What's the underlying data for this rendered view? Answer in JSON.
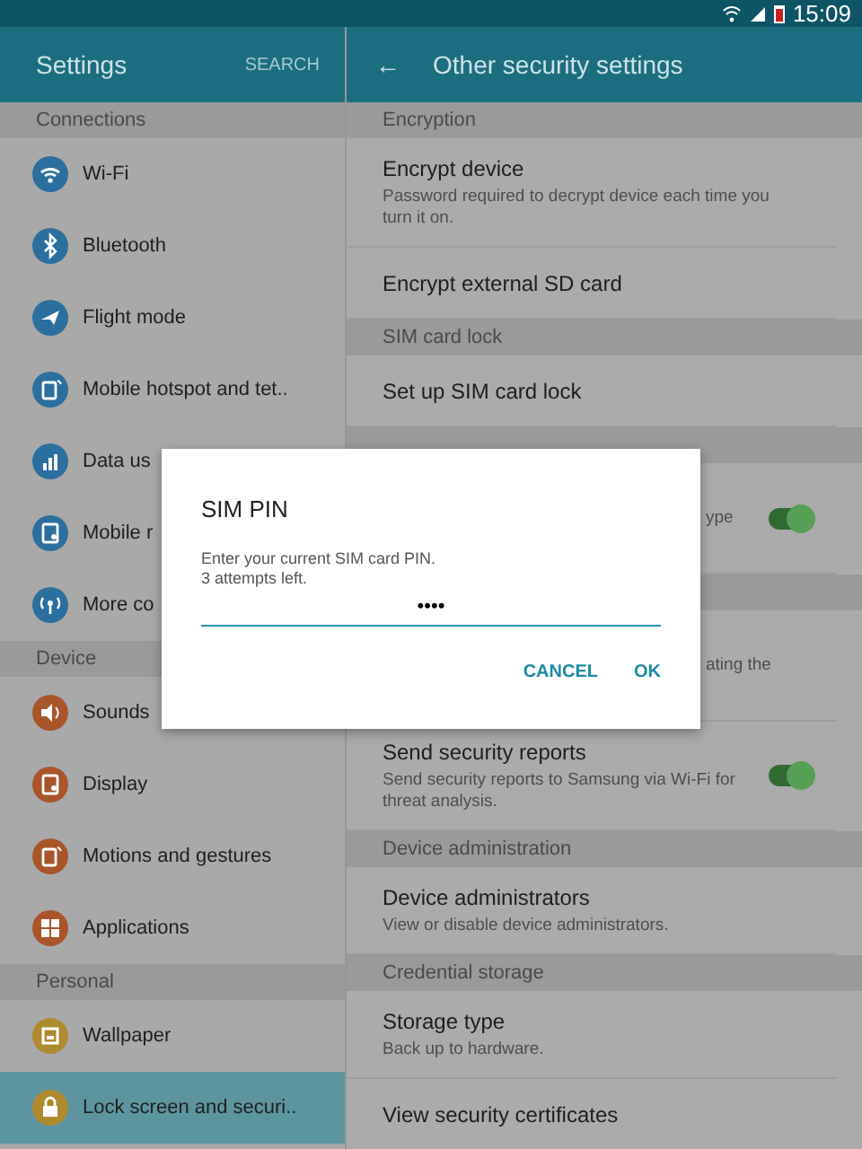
{
  "status_bar": {
    "time": "15:09"
  },
  "left": {
    "title": "Settings",
    "search": "SEARCH",
    "sections": [
      {
        "header": "Connections",
        "items": [
          {
            "label": "Wi-Fi",
            "kind": "wifi",
            "color": "#2a6f9e",
            "selected": false
          },
          {
            "label": "Bluetooth",
            "kind": "bluetooth",
            "color": "#2a6f9e",
            "selected": false
          },
          {
            "label": "Flight mode",
            "kind": "plane",
            "color": "#2a6f9e",
            "selected": false
          },
          {
            "label": "Mobile hotspot and tet..",
            "kind": "hotspot",
            "color": "#2a6f9e",
            "selected": false
          },
          {
            "label": "Data us",
            "kind": "bars",
            "color": "#2a6f9e",
            "selected": false
          },
          {
            "label": "Mobile r",
            "kind": "phone",
            "color": "#2a6f9e",
            "selected": false
          },
          {
            "label": "More co",
            "kind": "antenna",
            "color": "#2a6f9e",
            "selected": false
          }
        ]
      },
      {
        "header": "Device",
        "items": [
          {
            "label": "Sounds",
            "kind": "speaker",
            "color": "#a8552a",
            "selected": false
          },
          {
            "label": "Display",
            "kind": "phone",
            "color": "#a8552a",
            "selected": false
          },
          {
            "label": "Motions and gestures",
            "kind": "hotspot",
            "color": "#a8552a",
            "selected": false
          },
          {
            "label": "Applications",
            "kind": "grid",
            "color": "#a8552a",
            "selected": false
          }
        ]
      },
      {
        "header": "Personal",
        "items": [
          {
            "label": "Wallpaper",
            "kind": "frame",
            "color": "#b08a2e",
            "selected": false
          },
          {
            "label": "Lock screen and securi..",
            "kind": "lock",
            "color": "#b08a2e",
            "selected": true
          }
        ]
      }
    ]
  },
  "right": {
    "back": "←",
    "title": "Other security settings",
    "sections": [
      {
        "header": "Encryption",
        "rows": [
          {
            "kind": "item",
            "title": "Encrypt device",
            "subtitle": "Password required to decrypt device each time you turn it on."
          },
          {
            "kind": "item",
            "title": "Encrypt external SD card"
          }
        ]
      },
      {
        "header": "SIM card lock",
        "rows": [
          {
            "kind": "item",
            "title": "Set up SIM card lock"
          }
        ]
      },
      {
        "rows": [
          {
            "kind": "partial",
            "subtitle": "ype",
            "on": true
          }
        ]
      },
      {
        "rows": [
          {
            "kind": "partial",
            "subtitle": "ating the"
          },
          {
            "kind": "item",
            "title": "Send security reports",
            "subtitle": "Send security reports to Samsung via Wi-Fi for threat analysis.",
            "on": true
          }
        ]
      },
      {
        "header": "Device administration",
        "rows": [
          {
            "kind": "item",
            "title": "Device administrators",
            "subtitle": "View or disable device administrators."
          }
        ]
      },
      {
        "header": "Credential storage",
        "rows": [
          {
            "kind": "item",
            "title": "Storage type",
            "subtitle": "Back up to hardware."
          },
          {
            "kind": "item",
            "title": "View security certificates"
          }
        ]
      }
    ]
  },
  "dialog": {
    "title": "SIM PIN",
    "message": "Enter your current SIM card PIN.\n3 attempts left.",
    "value": "••••",
    "buttons": [
      "CANCEL",
      "OK"
    ]
  }
}
